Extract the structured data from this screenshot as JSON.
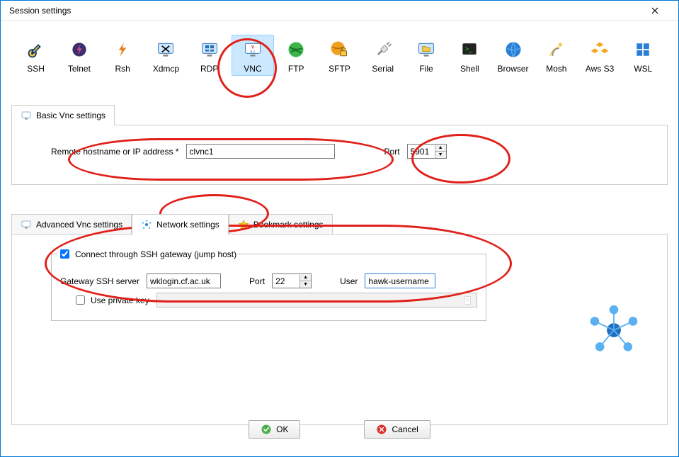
{
  "window": {
    "title": "Session settings"
  },
  "session_types": [
    {
      "label": "SSH"
    },
    {
      "label": "Telnet"
    },
    {
      "label": "Rsh"
    },
    {
      "label": "Xdmcp"
    },
    {
      "label": "RDP"
    },
    {
      "label": "VNC"
    },
    {
      "label": "FTP"
    },
    {
      "label": "SFTP"
    },
    {
      "label": "Serial"
    },
    {
      "label": "File"
    },
    {
      "label": "Shell"
    },
    {
      "label": "Browser"
    },
    {
      "label": "Mosh"
    },
    {
      "label": "Aws S3"
    },
    {
      "label": "WSL"
    }
  ],
  "basic": {
    "tab_label": "Basic Vnc settings",
    "hostname_label": "Remote hostname or IP address *",
    "hostname_value": "clvnc1",
    "port_label": "Port",
    "port_value": "5901"
  },
  "adv_tabs": {
    "advanced": "Advanced Vnc settings",
    "network": "Network settings",
    "bookmark": "Bookmark settings"
  },
  "gateway": {
    "legend": "Connect through SSH gateway (jump host)",
    "server_label": "Gateway SSH server",
    "server_value": "wklogin.cf.ac.uk",
    "port_label": "Port",
    "port_value": "22",
    "user_label": "User",
    "user_value": "hawk-username",
    "private_key_label": "Use private key"
  },
  "buttons": {
    "ok": "OK",
    "cancel": "Cancel"
  },
  "colors": {
    "annotation": "#e1201a",
    "accent": "#0078d7"
  }
}
